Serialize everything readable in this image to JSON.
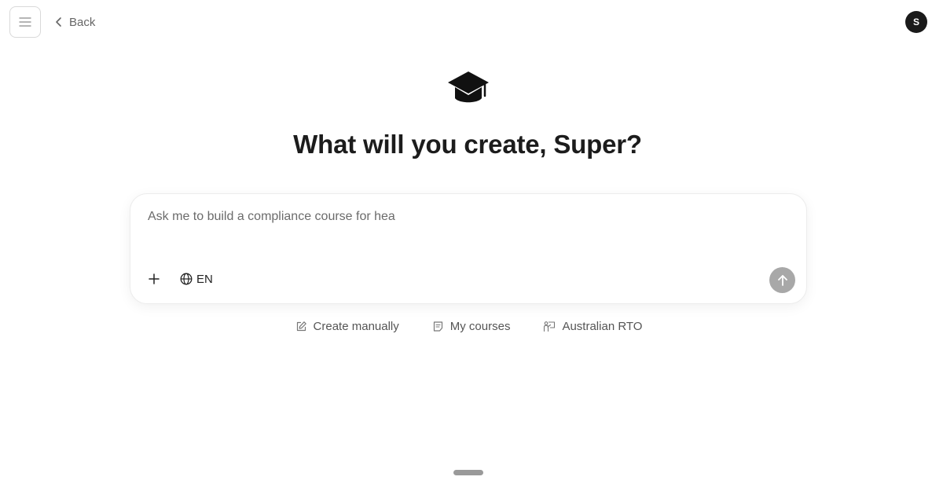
{
  "header": {
    "menu_icon": "hamburger-icon",
    "back_label": "Back",
    "back_icon": "chevron-left-icon",
    "avatar_initial": "S"
  },
  "hero": {
    "logo_icon": "graduation-cap-icon",
    "headline": "What will you create, Super?"
  },
  "composer": {
    "placeholder": "Ask me to build a compliance course for hea",
    "add_icon": "plus-icon",
    "language_icon": "globe-icon",
    "language_label": "EN",
    "send_icon": "arrow-up-icon",
    "send_color": "#a8a8a8"
  },
  "quick_links": [
    {
      "label": "Create manually",
      "icon": "edit-icon"
    },
    {
      "label": "My courses",
      "icon": "notes-icon"
    },
    {
      "label": "Australian RTO",
      "icon": "presenter-icon"
    }
  ]
}
